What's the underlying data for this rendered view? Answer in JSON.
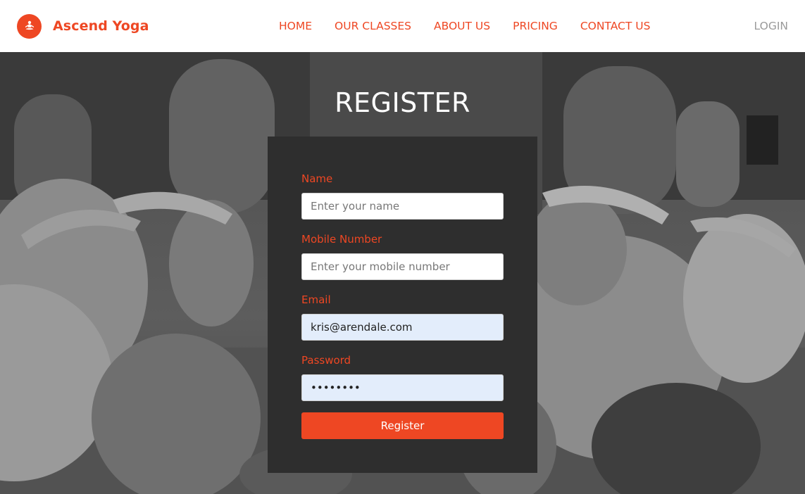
{
  "brand": {
    "name": "Ascend Yoga",
    "logo_icon": "meditation-icon",
    "accent": "#ee4723"
  },
  "nav": {
    "items": [
      "HOME",
      "OUR CLASSES",
      "ABOUT US",
      "PRICING",
      "CONTACT US"
    ],
    "login": "LOGIN"
  },
  "page": {
    "title": "REGISTER"
  },
  "form": {
    "name": {
      "label": "Name",
      "placeholder": "Enter your name",
      "value": ""
    },
    "mobile": {
      "label": "Mobile Number",
      "placeholder": "Enter your mobile number",
      "value": ""
    },
    "email": {
      "label": "Email",
      "placeholder": "",
      "value": "kris@arendale.com"
    },
    "password": {
      "label": "Password",
      "placeholder": "",
      "value": "kris1234"
    },
    "submit_label": "Register"
  },
  "colors": {
    "accent": "#ee4723",
    "panel": "#2e2e2e",
    "header_bg": "#ffffff",
    "login_text": "#9a9a9a"
  }
}
